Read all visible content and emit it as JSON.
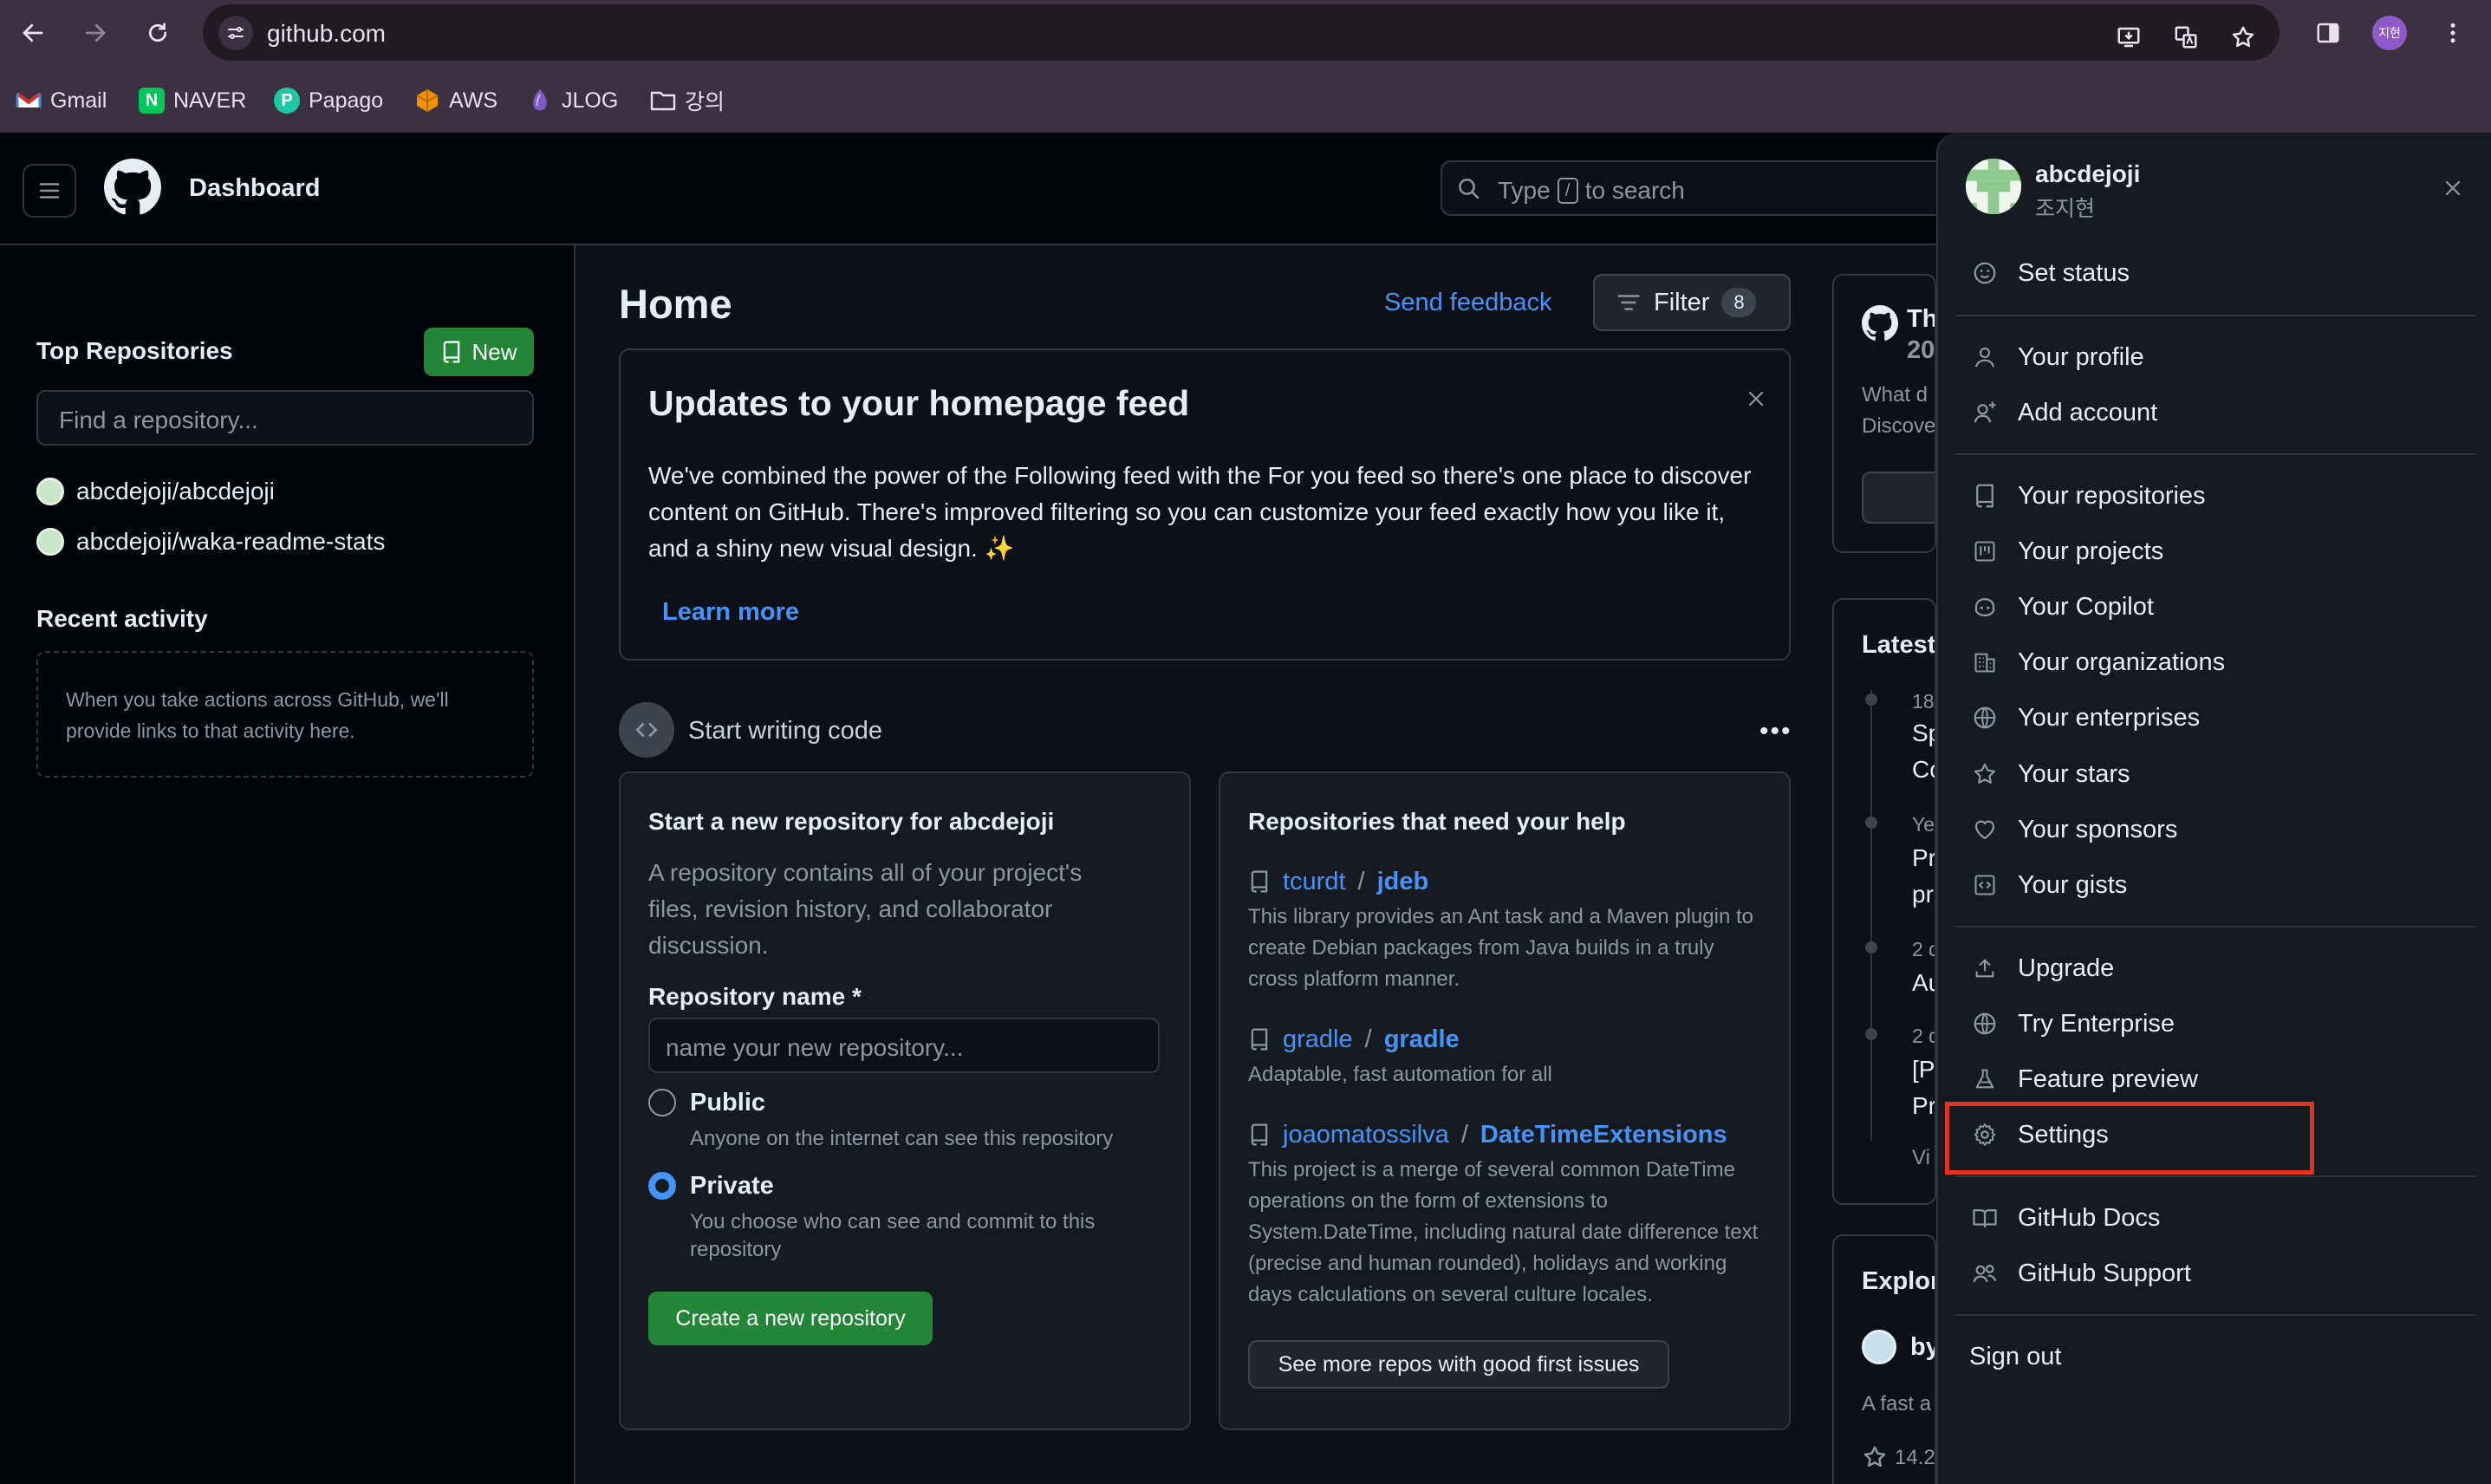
{
  "browser": {
    "url": "github.com",
    "profile_initials": "지현",
    "bookmarks": [
      {
        "label": "Gmail",
        "icon": "gmail-icon",
        "color": "#d93025"
      },
      {
        "label": "NAVER",
        "icon": "naver-icon",
        "color": "#03c75a"
      },
      {
        "label": "Papago",
        "icon": "papago-icon",
        "color": "#1ec8a5"
      },
      {
        "label": "AWS",
        "icon": "aws-icon",
        "color": "#f29100"
      },
      {
        "label": "JLOG",
        "icon": "jlog-icon",
        "color": "#7c5cc4"
      },
      {
        "label": "강의",
        "icon": "folder-icon",
        "color": "#e8e0ec"
      }
    ]
  },
  "header": {
    "title": "Dashboard",
    "search_before": "Type",
    "search_key": "/",
    "search_after": "to search"
  },
  "sidebar": {
    "top_repos_title": "Top Repositories",
    "new_button": "New",
    "find_placeholder": "Find a repository...",
    "repos": [
      "abcdejoji/abcdejoji",
      "abcdejoji/waka-readme-stats"
    ],
    "recent_title": "Recent activity",
    "recent_empty": "When you take actions across GitHub, we'll provide links to that activity here."
  },
  "feed": {
    "home_title": "Home",
    "send_feedback": "Send feedback",
    "filter_label": "Filter",
    "filter_count": "8",
    "updates": {
      "title": "Updates to your homepage feed",
      "body": "We've combined the power of the Following feed with the For you feed so there's one place to discover content on GitHub. There's improved filtering so you can customize your feed exactly how you like it, and a shiny new visual design. ✨",
      "learn_more": "Learn more"
    },
    "start_writing": "Start writing code",
    "more_dots": "•••",
    "new_repo": {
      "title": "Start a new repository for abcdejoji",
      "description": "A repository contains all of your project's files, revision history, and collaborator discussion.",
      "name_label": "Repository name *",
      "name_placeholder": "name your new repository...",
      "public_label": "Public",
      "public_desc": "Anyone on the internet can see this repository",
      "private_label": "Private",
      "private_desc": "You choose who can see and commit to this repository",
      "visibility_selected": "Private",
      "create_button": "Create a new repository"
    },
    "help": {
      "title": "Repositories that need your help",
      "repos": [
        {
          "owner": "tcurdt",
          "name": "jdeb",
          "desc": "This library provides an Ant task and a Maven plugin to create Debian packages from Java builds in a truly cross platform manner."
        },
        {
          "owner": "gradle",
          "name": "gradle",
          "desc": "Adaptable, fast automation for all"
        },
        {
          "owner": "joaomatossilva",
          "name": "DateTimeExtensions",
          "desc": "This project is a merge of several common DateTime operations on the form of extensions to System.DateTime, including natural date difference text (precise and human rounded), holidays and working days calculations on several culture locales."
        }
      ],
      "see_more": "See more repos with good first issues"
    }
  },
  "right_column": {
    "card1_title": "Th",
    "card1_sub": "20",
    "card1_line1": "What d",
    "card1_line2": "Discove",
    "latest_title": "Latest",
    "latest_items": [
      {
        "date": "18",
        "line1": "Sp",
        "line2": "Co"
      },
      {
        "date": "Ye",
        "line1": "Pr",
        "line2": "pr"
      },
      {
        "date": "2 d",
        "line1": "Au",
        "line2": ""
      },
      {
        "date": "2 d",
        "line1": "[P",
        "line2": "Pr"
      }
    ],
    "latest_more": "Vi",
    "explore_title": "Explor",
    "explore_repo": "by",
    "explore_desc": "A fast a",
    "explore_stars": "14.2"
  },
  "user_menu": {
    "username": "abcdejoji",
    "full_name": "조지현",
    "items": [
      {
        "label": "Set status",
        "icon": "smiley-icon"
      },
      {
        "label": "Your profile",
        "icon": "person-icon"
      },
      {
        "label": "Add account",
        "icon": "person-add-icon"
      },
      {
        "label": "Your repositories",
        "icon": "repo-icon"
      },
      {
        "label": "Your projects",
        "icon": "project-icon"
      },
      {
        "label": "Your Copilot",
        "icon": "copilot-icon"
      },
      {
        "label": "Your organizations",
        "icon": "organization-icon"
      },
      {
        "label": "Your enterprises",
        "icon": "globe-icon"
      },
      {
        "label": "Your stars",
        "icon": "star-icon"
      },
      {
        "label": "Your sponsors",
        "icon": "heart-icon"
      },
      {
        "label": "Your gists",
        "icon": "code-square-icon"
      },
      {
        "label": "Upgrade",
        "icon": "upload-icon"
      },
      {
        "label": "Try Enterprise",
        "icon": "globe-icon"
      },
      {
        "label": "Feature preview",
        "icon": "beaker-icon"
      },
      {
        "label": "Settings",
        "icon": "gear-icon"
      },
      {
        "label": "GitHub Docs",
        "icon": "book-icon"
      },
      {
        "label": "GitHub Support",
        "icon": "people-icon"
      },
      {
        "label": "Sign out",
        "icon": ""
      }
    ],
    "highlight_color": "#e0321c"
  },
  "colors": {
    "accent_link": "#4493f8",
    "primary_button": "#238636",
    "background": "#0d1117",
    "browser_frame": "#3c3141"
  }
}
